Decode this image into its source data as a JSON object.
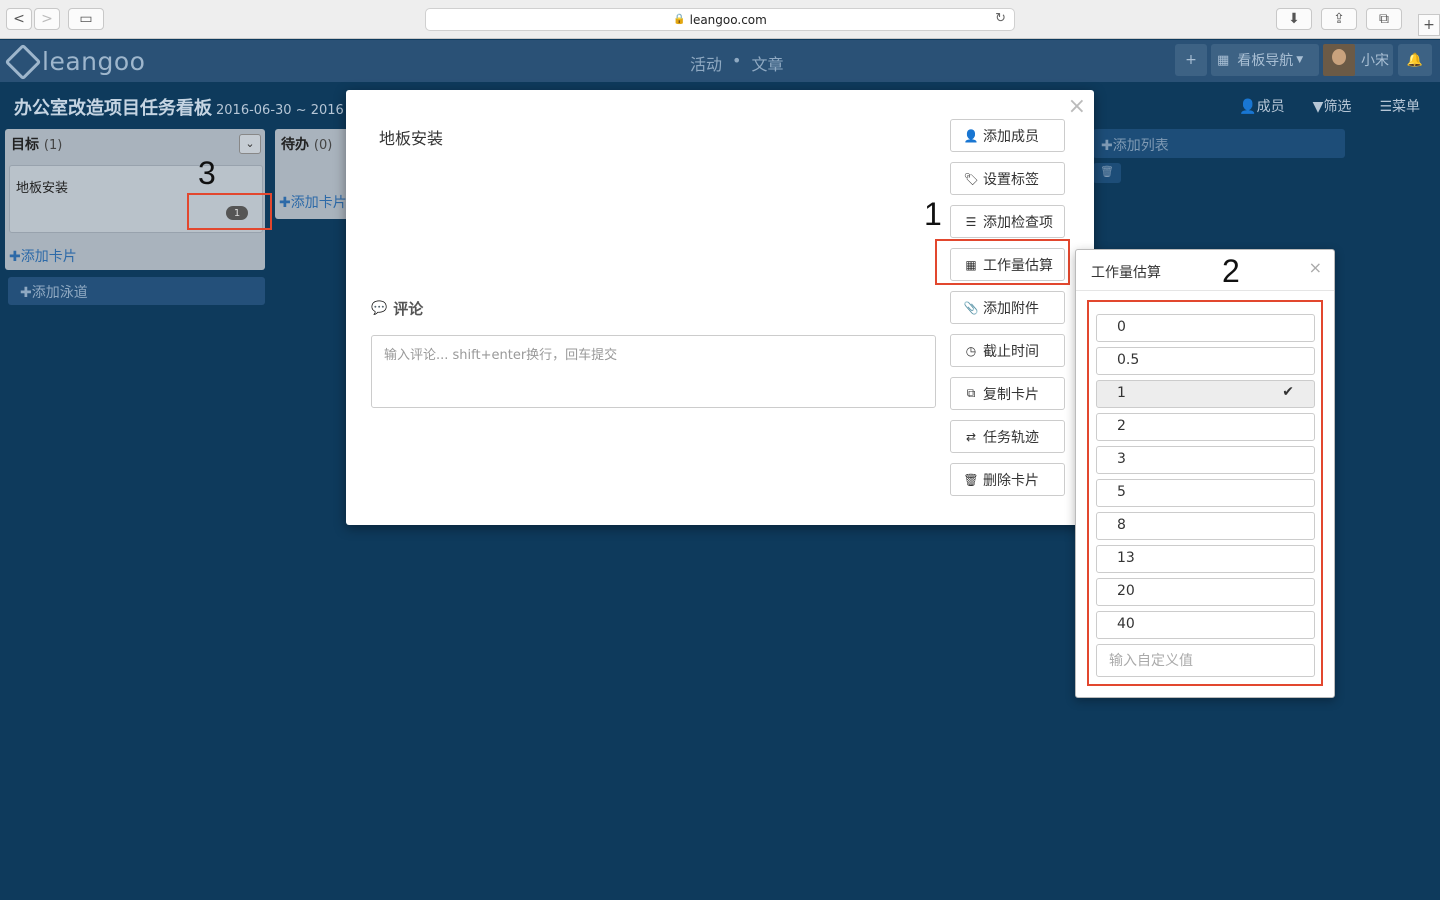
{
  "browser": {
    "url": "leangoo.com",
    "back": "<",
    "forward": ">",
    "sidebar": "▭",
    "download": "⬇",
    "share": "⇪",
    "tabs": "⧉",
    "new_tab": "+",
    "reload": "↻",
    "lock": "🔒"
  },
  "header": {
    "logo_text": "leangoo",
    "nav": [
      "活动",
      "•",
      "文章"
    ],
    "add_icon": "+",
    "board_nav_label": "看板导航",
    "user_name": "小宋",
    "bell_icon": "🔔"
  },
  "board": {
    "title": "办公室改造项目任务看板",
    "date": "2016-06-30 ~ 2016",
    "actions": [
      "成员",
      "筛选",
      "菜单"
    ]
  },
  "lists": [
    {
      "name": "目标",
      "count": "(1)",
      "card_title": "地板安装",
      "badge": "1",
      "add_card": "添加卡片"
    },
    {
      "name": "待办",
      "count": "(0)",
      "add_card": "添加卡片"
    }
  ],
  "add_swimlane": "添加泳道",
  "add_list": "添加列表",
  "modal": {
    "card_name": "地板安装",
    "comment_label": "评论",
    "comment_placeholder": "输入评论... shift+enter换行，回车提交",
    "actions": [
      "添加成员",
      "设置标签",
      "添加检查项",
      "工作量估算",
      "添加附件",
      "截止时间",
      "复制卡片",
      "任务轨迹",
      "删除卡片"
    ]
  },
  "popover": {
    "title": "工作量估算",
    "options": [
      "0",
      "0.5",
      "1",
      "2",
      "3",
      "5",
      "8",
      "13",
      "20",
      "40"
    ],
    "selected": "1",
    "custom_placeholder": "输入自定义值"
  },
  "annotations": [
    "1",
    "2",
    "3"
  ],
  "colors": {
    "highlight": "#e2472e",
    "background": "#0e3a5c",
    "header": "#2a5176"
  }
}
